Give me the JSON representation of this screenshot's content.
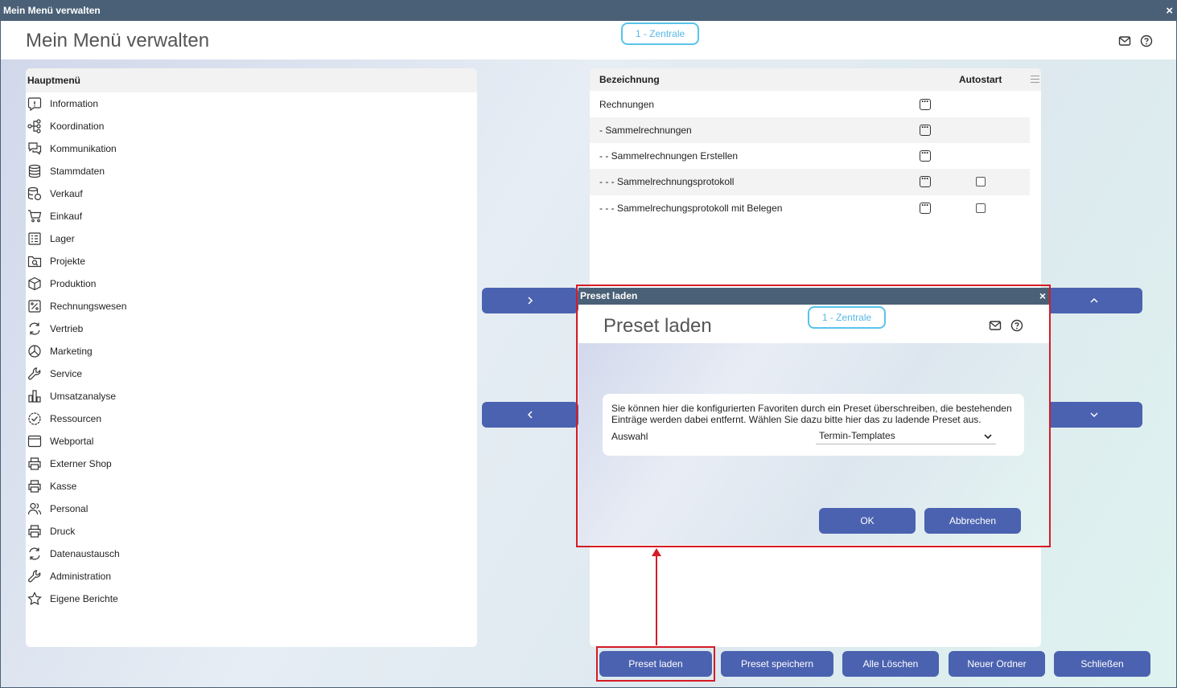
{
  "window": {
    "title": "Mein Menü verwalten",
    "close": "×"
  },
  "header": {
    "title": "Mein Menü verwalten",
    "branch": "1 - Zentrale"
  },
  "left_panel": {
    "heading": "Hauptmenü",
    "items": [
      {
        "label": "Information",
        "icon": "info-icon"
      },
      {
        "label": "Koordination",
        "icon": "hierarchy-icon"
      },
      {
        "label": "Kommunikation",
        "icon": "chat-icon"
      },
      {
        "label": "Stammdaten",
        "icon": "database-icon"
      },
      {
        "label": "Verkauf",
        "icon": "sales-icon"
      },
      {
        "label": "Einkauf",
        "icon": "cart-icon"
      },
      {
        "label": "Lager",
        "icon": "warehouse-icon"
      },
      {
        "label": "Projekte",
        "icon": "folder-search-icon"
      },
      {
        "label": "Produktion",
        "icon": "box-icon"
      },
      {
        "label": "Rechnungswesen",
        "icon": "percent-icon"
      },
      {
        "label": "Vertrieb",
        "icon": "refresh-icon"
      },
      {
        "label": "Marketing",
        "icon": "pie-chart-icon"
      },
      {
        "label": "Service",
        "icon": "wrench-icon"
      },
      {
        "label": "Umsatzanalyse",
        "icon": "bar-chart-icon"
      },
      {
        "label": "Ressourcen",
        "icon": "check-circle-icon"
      },
      {
        "label": "Webportal",
        "icon": "browser-icon"
      },
      {
        "label": "Externer Shop",
        "icon": "printer-icon"
      },
      {
        "label": "Kasse",
        "icon": "printer-icon"
      },
      {
        "label": "Personal",
        "icon": "users-icon"
      },
      {
        "label": "Druck",
        "icon": "printer-icon"
      },
      {
        "label": "Datenaustausch",
        "icon": "refresh-icon"
      },
      {
        "label": "Administration",
        "icon": "wrench-icon"
      },
      {
        "label": "Eigene Berichte",
        "icon": "star-icon"
      }
    ]
  },
  "right_panel": {
    "col_name": "Bezeichnung",
    "col_autostart": "Autostart",
    "rows": [
      {
        "label": "Rechnungen",
        "has_autostart": false
      },
      {
        "label": "- Sammelrechnungen",
        "has_autostart": false
      },
      {
        "label": "- - Sammelrechnungen Erstellen",
        "has_autostart": false
      },
      {
        "label": "- - - Sammelrechnungsprotokoll",
        "has_autostart": true,
        "checked": false
      },
      {
        "label": "- - - Sammelrechungsprotokoll mit Belegen",
        "has_autostart": true,
        "checked": false
      }
    ]
  },
  "buttons": {
    "preset_laden": "Preset laden",
    "preset_speichern": "Preset speichern",
    "alle_loeschen": "Alle Löschen",
    "neuer_ordner": "Neuer Ordner",
    "schliessen": "Schließen"
  },
  "dialog": {
    "title": "Preset laden",
    "close": "×",
    "heading": "Preset laden",
    "branch": "1 - Zentrale",
    "message": "Sie können hier die konfigurierten Favoriten durch ein Preset überschreiben, die bestehenden Einträge werden dabei entfernt. Wählen Sie dazu bitte hier das zu ladende Preset aus.",
    "select_label": "Auswahl",
    "select_value": "Termin-Templates",
    "ok": "OK",
    "cancel": "Abbrechen"
  },
  "colors": {
    "titlebar": "#4a6076",
    "button": "#4b62b0",
    "highlight": "#d61b25",
    "branch_border": "#58c4ea"
  }
}
